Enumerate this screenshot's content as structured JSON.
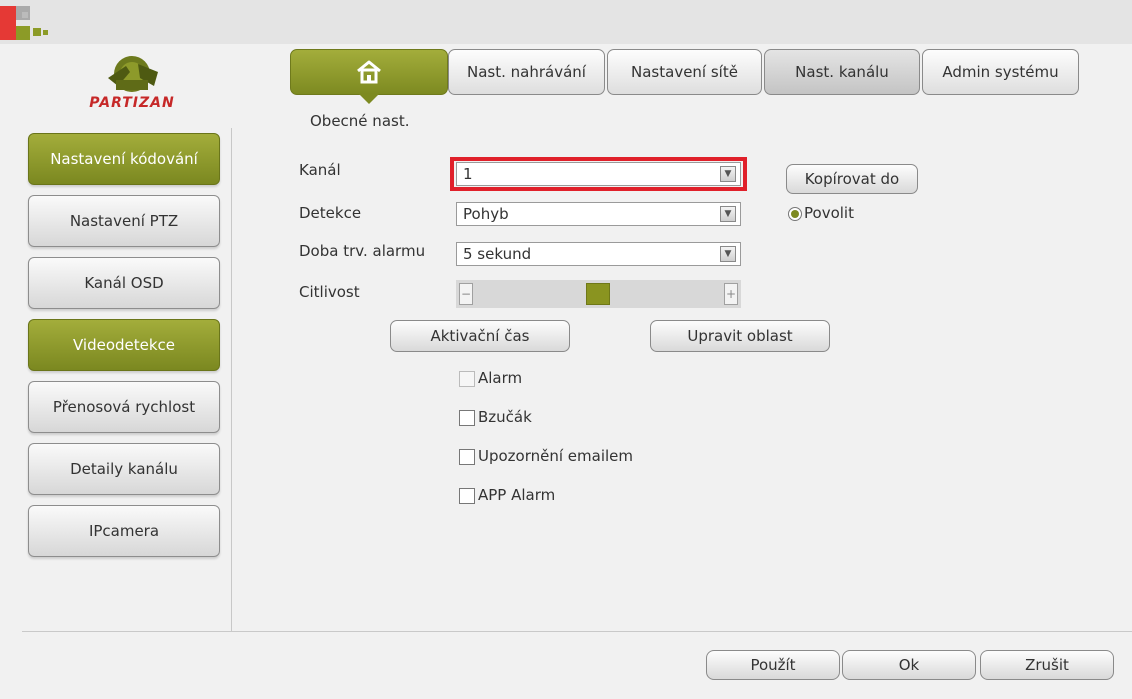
{
  "brand": {
    "name": "PARTIZAN"
  },
  "tabs": [
    {
      "label": "",
      "icon": "home-icon"
    },
    {
      "label": "Nast. nahrávání"
    },
    {
      "label": "Nastavení sítě"
    },
    {
      "label": "Nast. kanálu"
    },
    {
      "label": "Admin systému"
    }
  ],
  "subtitle": "Obecné nast.",
  "sidebar": {
    "items": [
      {
        "label": "Nastavení kódování"
      },
      {
        "label": "Nastavení PTZ"
      },
      {
        "label": "Kanál OSD"
      },
      {
        "label": "Videodetekce"
      },
      {
        "label": "Přenosová rychlost"
      },
      {
        "label": "Detaily kanálu"
      },
      {
        "label": "IPcamera"
      }
    ]
  },
  "form": {
    "channel_label": "Kanál",
    "channel_value": "1",
    "detection_label": "Detekce",
    "detection_value": "Pohyb",
    "alarm_duration_label": "Doba trv. alarmu",
    "alarm_duration_value": "5 sekund",
    "sensitivity_label": "Citlivost",
    "sensitivity_level": 0.5,
    "copy_to_label": "Kopírovat do",
    "enable_label": "Povolit",
    "activation_time_label": "Aktivační čas",
    "edit_area_label": "Upravit oblast",
    "checkboxes": [
      {
        "label": "Alarm",
        "checked": false,
        "disabled": true
      },
      {
        "label": "Bzučák",
        "checked": false
      },
      {
        "label": "Upozornění emailem",
        "checked": false
      },
      {
        "label": "APP Alarm",
        "checked": false
      }
    ]
  },
  "footer": {
    "apply_label": "Použít",
    "ok_label": "Ok",
    "cancel_label": "Zrušit"
  },
  "colors": {
    "accent": "#8a9420",
    "highlight": "#e0202a",
    "brand_red": "#c62828"
  }
}
